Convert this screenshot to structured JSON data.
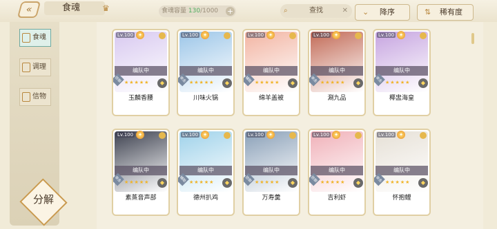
{
  "header": {
    "back_icon": "double-chevron-left-icon",
    "title": "食魂",
    "crown_icon": "crown-icon",
    "capacity_label": "食魂容量",
    "capacity_current": "130",
    "capacity_total": "/1000",
    "capacity_plus": "+",
    "search_text": "查找",
    "search_clear": "✕",
    "sort_order_label": "降序",
    "sort_field_label": "稀有度"
  },
  "sidebar": {
    "items": [
      {
        "label": "食魂",
        "active": true
      },
      {
        "label": "调理",
        "active": false
      },
      {
        "label": "信物",
        "active": false
      }
    ],
    "decompose_label": "分解"
  },
  "cards": [
    {
      "level": "Lv.100",
      "status": "编队中",
      "name": "玉麟香腰",
      "tag": "防御",
      "color": "#d8c9f0"
    },
    {
      "level": "Lv.100",
      "status": "编队中",
      "name": "川味火锅",
      "tag": "攻击",
      "color": "#9cc6e8"
    },
    {
      "level": "Lv.100",
      "status": "编队中",
      "name": "绵羊盖被",
      "tag": "辅助",
      "color": "#f2b4a2"
    },
    {
      "level": "Lv.100",
      "status": "编队中",
      "name": "涮九品",
      "tag": "攻击",
      "color": "#c26a56"
    },
    {
      "level": "Lv.100",
      "status": "编队中",
      "name": "椰盅海皇",
      "tag": "攻击",
      "color": "#c6a4e0"
    },
    {
      "level": "Lv.100",
      "status": "编队中",
      "name": "素蒸音声部",
      "tag": "攻击",
      "color": "#3e4250"
    },
    {
      "level": "Lv.100",
      "status": "编队中",
      "name": "德州扒鸡",
      "tag": "辅助",
      "color": "#9fd2ea"
    },
    {
      "level": "Lv.100",
      "status": "编队中",
      "name": "万寿羹",
      "tag": "防御",
      "color": "#8aa0b8"
    },
    {
      "level": "Lv.100",
      "status": "编队中",
      "name": "吉利虾",
      "tag": "防御",
      "color": "#f0b0b8"
    },
    {
      "level": "Lv.100",
      "status": "编队中",
      "name": "怀抱鲤",
      "tag": "攻击",
      "color": "#e6e0d6"
    }
  ],
  "colors": {
    "accent": "#b8873d",
    "active_tab": "#dff0ea",
    "capacity_number": "#4fae5f"
  }
}
